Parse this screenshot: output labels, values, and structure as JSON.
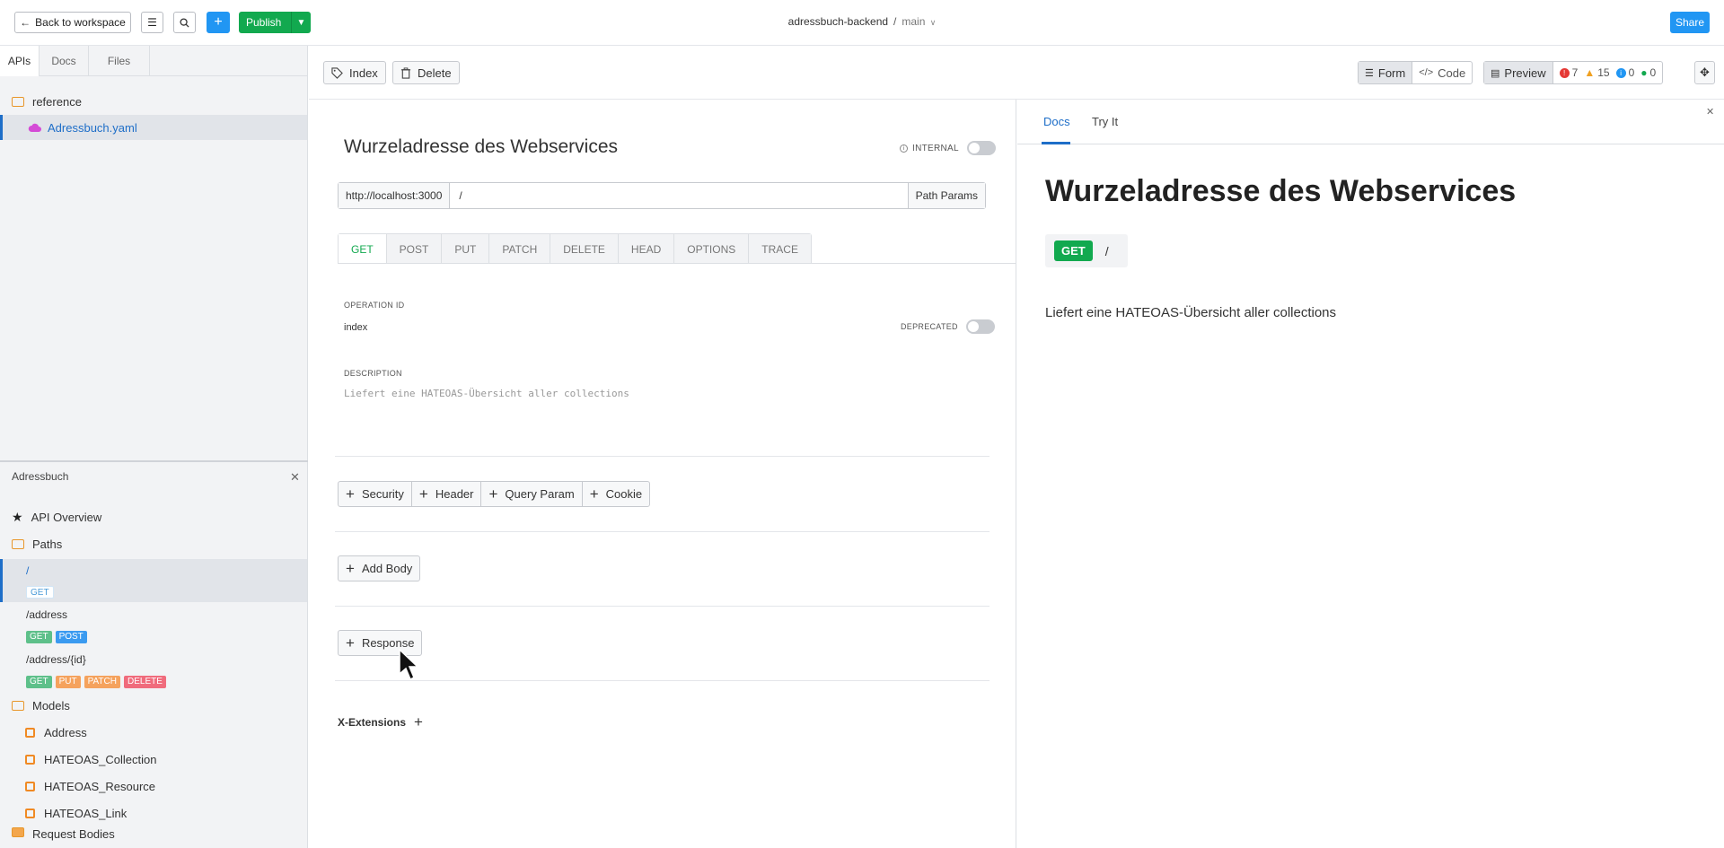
{
  "topbar": {
    "back_label": "Back to workspace",
    "publish_label": "Publish",
    "project": "adressbuch-backend",
    "separator": "/",
    "branch": "main",
    "share_label": "Share"
  },
  "sidebar": {
    "tabs": [
      "APIs",
      "Docs",
      "Files"
    ],
    "tree": {
      "folder": "reference",
      "file": "Adressbuch.yaml"
    },
    "outline_title": "Adressbuch",
    "api_overview": "API Overview",
    "paths_label": "Paths",
    "paths": [
      {
        "path": "/",
        "methods": [
          "GET"
        ]
      },
      {
        "path": "/address",
        "methods": [
          "GET",
          "POST"
        ]
      },
      {
        "path": "/address/{id}",
        "methods": [
          "GET",
          "PUT",
          "PATCH",
          "DELETE"
        ]
      }
    ],
    "models_label": "Models",
    "models": [
      "Address",
      "HATEOAS_Collection",
      "HATEOAS_Resource",
      "HATEOAS_Link"
    ],
    "request_bodies_label": "Request Bodies"
  },
  "toolbar": {
    "index_label": "Index",
    "delete_label": "Delete",
    "form_label": "Form",
    "code_label": "Code",
    "preview_label": "Preview",
    "errors": "7",
    "warnings": "15",
    "info": "0",
    "hints": "0"
  },
  "editor": {
    "title": "Wurzeladresse des Webservices",
    "internal_label": "INTERNAL",
    "host": "http://localhost:3000",
    "path": "/",
    "path_params_label": "Path Params",
    "methods": [
      "GET",
      "POST",
      "PUT",
      "PATCH",
      "DELETE",
      "HEAD",
      "OPTIONS",
      "TRACE"
    ],
    "operation_id_label": "OPERATION ID",
    "operation_id": "index",
    "deprecated_label": "DEPRECATED",
    "description_label": "DESCRIPTION",
    "description": "Liefert eine HATEOAS-Übersicht aller collections",
    "param_buttons": [
      "Security",
      "Header",
      "Query Param",
      "Cookie"
    ],
    "add_body_label": "Add Body",
    "response_label": "Response",
    "x_extensions_label": "X-Extensions"
  },
  "preview": {
    "tabs": [
      "Docs",
      "Try It"
    ],
    "title": "Wurzeladresse des Webservices",
    "method": "GET",
    "path": "/",
    "description": "Liefert eine HATEOAS-Übersicht aller collections"
  },
  "colors": {
    "accent_blue": "#2196f3",
    "publish_green": "#12a94f",
    "get_green": "#12a94f",
    "doc_tab_blue": "#1e6ec8"
  }
}
